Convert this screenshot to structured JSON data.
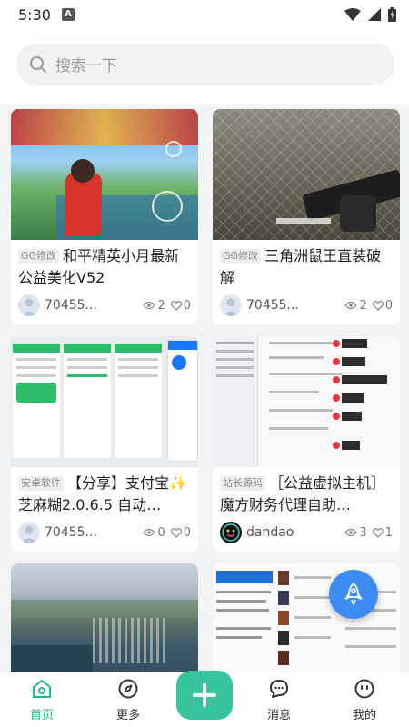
{
  "status_bar": {
    "time": "5:30",
    "notification_letter": "A"
  },
  "search": {
    "placeholder": "搜索一下"
  },
  "cards": [
    {
      "tag": "GG修改",
      "title": "和平精英小月最新公益美化V52",
      "author": "70455...",
      "views": "2",
      "likes": "0"
    },
    {
      "tag": "GG修改",
      "title": "三角洲鼠王直装破解",
      "author": "70455...",
      "views": "2",
      "likes": "0"
    },
    {
      "tag": "安卓软件",
      "title": "【分享】支付宝✨芝麻糊2.0.6.5 自动…",
      "author": "70455...",
      "views": "0",
      "likes": "0"
    },
    {
      "tag": "站长源码",
      "title": "［公益虚拟主机］魔方财务代理自助…",
      "author": "dandao",
      "views": "3",
      "likes": "1"
    }
  ],
  "bottom_nav": {
    "home": "首页",
    "more": "更多",
    "messages": "消息",
    "mine": "我的"
  },
  "colors": {
    "accent": "#35c49b",
    "fab": "#3d8cf3",
    "background": "#f2f3f5"
  },
  "icons": [
    "search-icon",
    "wifi-icon",
    "signal-icon",
    "battery-icon",
    "eye-icon",
    "heart-icon",
    "rocket-icon",
    "home-icon",
    "compass-icon",
    "plus-icon",
    "chat-icon",
    "face-icon"
  ]
}
